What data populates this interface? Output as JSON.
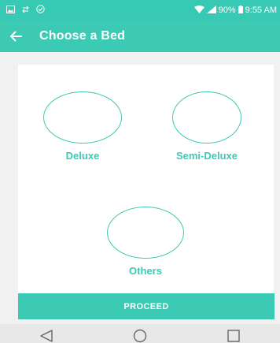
{
  "status_bar": {
    "battery": "90%",
    "time": "9:55 AM"
  },
  "app_bar": {
    "title": "Choose a Bed"
  },
  "options": [
    {
      "label": "Deluxe"
    },
    {
      "label": "Semi-Deluxe"
    },
    {
      "label": "Others"
    }
  ],
  "proceed_label": "PROCEED",
  "colors": {
    "accent": "#3ccab5",
    "status_bar": "#38c9b4",
    "background": "#f1f1f1"
  },
  "icons": [
    "gallery-icon",
    "sync-icon",
    "check-circle-icon",
    "wifi-icon",
    "signal-icon",
    "battery-icon",
    "back-arrow-icon",
    "nav-back-icon",
    "nav-home-icon",
    "nav-recents-icon"
  ]
}
